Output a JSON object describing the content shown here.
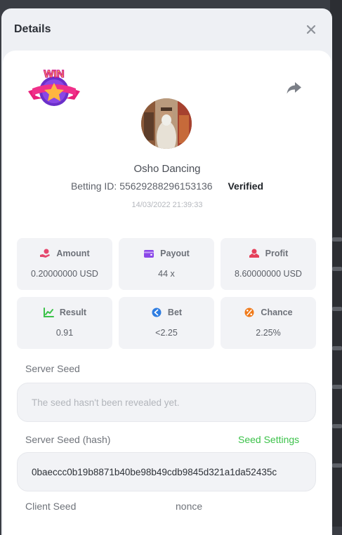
{
  "modal": {
    "title": "Details"
  },
  "game": {
    "name": "Osho Dancing",
    "betting_id_label": "Betting ID:",
    "betting_id": "55629288296153136",
    "verified_label": "Verified",
    "datetime": "14/03/2022 21:39:33",
    "badge_text": "WIN"
  },
  "stats": [
    {
      "label": "Amount",
      "value": "0.20000000 USD",
      "icon": "money-hand-icon",
      "color": "#e5476d"
    },
    {
      "label": "Payout",
      "value": "44 x",
      "icon": "wallet-icon",
      "color": "#8b48e8"
    },
    {
      "label": "Profit",
      "value": "8.60000000 USD",
      "icon": "profit-icon",
      "color": "#e5405a"
    },
    {
      "label": "Result",
      "value": "0.91",
      "icon": "chart-icon",
      "color": "#3cc24a"
    },
    {
      "label": "Bet",
      "value": "<2.25",
      "icon": "bet-icon",
      "color": "#2f7de1"
    },
    {
      "label": "Chance",
      "value": "2.25%",
      "icon": "percent-icon",
      "color": "#f07a1a"
    }
  ],
  "server_seed": {
    "label": "Server Seed",
    "placeholder": "The seed hasn't been revealed yet."
  },
  "server_seed_hash": {
    "label": "Server Seed (hash)",
    "link": "Seed Settings",
    "value": "0baeccc0b19b8871b40be98b49cdb9845d321a1da52435c"
  },
  "client_seed": {
    "label": "Client Seed",
    "nonce_label": "nonce"
  }
}
